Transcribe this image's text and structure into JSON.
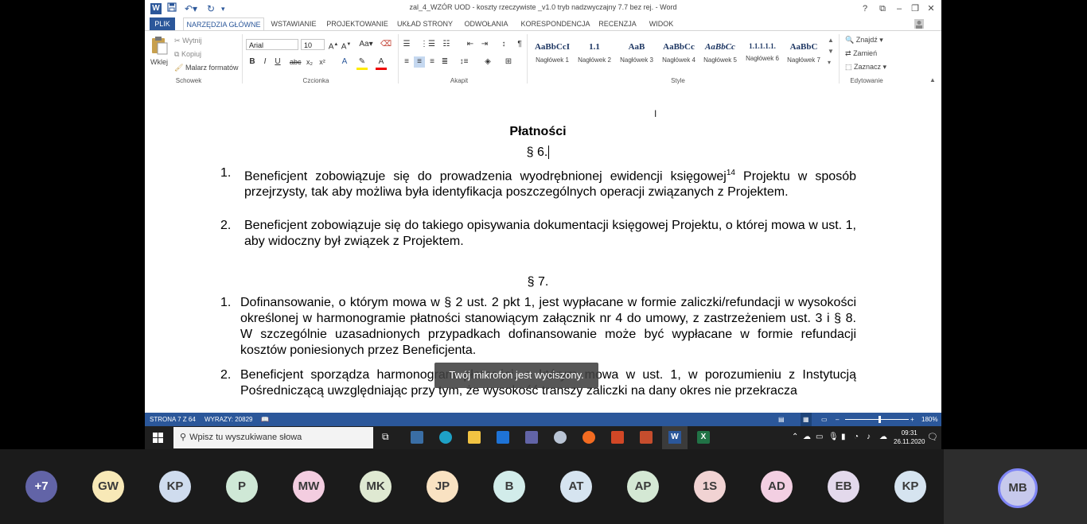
{
  "window": {
    "title": "zal_4_WZÓR UOD - koszty rzeczywiste _v1.0 tryb nadzwyczajny 7.7 bez rej. - Word",
    "help": "?",
    "controls": {
      "ribbon_opts": "⧉",
      "minimize": "–",
      "restore": "❐",
      "close": "✕"
    }
  },
  "tabs": [
    "PLIK",
    "NARZĘDZIA GŁÓWNE",
    "WSTAWIANIE",
    "PROJEKTOWANIE",
    "UKŁAD STRONY",
    "ODWOŁANIA",
    "KORESPONDENCJA",
    "RECENZJA",
    "WIDOK"
  ],
  "ribbon": {
    "clipboard": {
      "paste": "Wklej",
      "cut": "Wytnij",
      "copy": "Kopiuj",
      "format_painter": "Malarz formatów",
      "label": "Schowek"
    },
    "font": {
      "name": "Arial",
      "size": "10",
      "label": "Czcionka"
    },
    "paragraph": {
      "label": "Akapit"
    },
    "styles": {
      "label": "Style",
      "items": [
        {
          "sample": "AaBbCcI",
          "name": "Nagłówek 1"
        },
        {
          "sample": "1.1",
          "name": "Nagłówek 2"
        },
        {
          "sample": "AaB",
          "name": "Nagłówek 3"
        },
        {
          "sample": "AaBbCc",
          "name": "Nagłówek 4"
        },
        {
          "sample": "AaBbCc",
          "name": "Nagłówek 4"
        },
        {
          "sample": "AaBbCc",
          "name": "Nagłówek 5"
        },
        {
          "sample": "1.1.1.1.1.",
          "name": "Nagłówek 6"
        },
        {
          "sample": "AaBbC",
          "name": "Nagłówek 7"
        }
      ]
    },
    "editing": {
      "find": "Znajdź",
      "replace": "Zamień",
      "select": "Zaznacz",
      "label": "Edytowanie"
    }
  },
  "document": {
    "heading": "Płatności",
    "section6": "§ 6.",
    "s6_items": [
      {
        "num": "1.",
        "text_before": "Beneficjent zobowiązuje się do prowadzenia wyodrębnionej ewidencji księgowej",
        "sup": "14",
        "text_after": " Projektu w sposób przejrzysty, tak aby możliwa była identyfikacja poszczególnych operacji związanych z Projektem."
      },
      {
        "num": "2.",
        "text": "Beneficjent zobowiązuje się do takiego opisywania dokumentacji księgowej Projektu, o której mowa w ust. 1, aby widoczny był związek z Projektem."
      }
    ],
    "section7": "§ 7.",
    "s7_items": [
      {
        "num": "1.",
        "text": "Dofinansowanie, o którym mowa w § 2 ust. 2 pkt 1, jest wypłacane w formie zaliczki/refundacji w wysokości określonej w harmonogramie płatności stanowiącym załącznik nr 4 do umowy, z zastrzeżeniem ust. 3 i § 8. W szczególnie uzasadnionych przypadkach dofinansowanie może być wypłacane w formie refundacji kosztów poniesionych przez Beneficjenta."
      },
      {
        "num": "2.",
        "text": "Beneficjent sporządza harmonogram płatności, o którym mowa w ust. 1, w porozumieniu z Instytucją Pośredniczącą uwzględniając przy tym, że wysokość transzy zaliczki na dany okres nie przekracza"
      }
    ],
    "toast": "Twój mikrofon jest wyciszony."
  },
  "statusbar": {
    "page": "STRONA 7 Z 64",
    "words": "WYRAZY: 20829",
    "zoom": "180%"
  },
  "taskbar": {
    "search_placeholder": "Wpisz tu wyszukiwane słowa",
    "time": "09:31",
    "date": "26.11.2020"
  },
  "meeting": {
    "participants": [
      {
        "initials": "+7",
        "color": "#6264a7"
      },
      {
        "initials": "GW",
        "color": "#f8e9b7"
      },
      {
        "initials": "KP",
        "color": "#cfdcee"
      },
      {
        "initials": "P",
        "color": "#cfe8d6"
      },
      {
        "initials": "MW",
        "color": "#f3cde0"
      },
      {
        "initials": "MK",
        "color": "#dfe9d2"
      },
      {
        "initials": "JP",
        "color": "#f9e2c2"
      },
      {
        "initials": "B",
        "color": "#d2ecea"
      },
      {
        "initials": "AT",
        "color": "#d6e4f0"
      },
      {
        "initials": "AP",
        "color": "#d4e8d4"
      },
      {
        "initials": "1S",
        "color": "#f1d3d3"
      },
      {
        "initials": "AD",
        "color": "#f3cfe2"
      },
      {
        "initials": "EB",
        "color": "#e3d9ec"
      },
      {
        "initials": "KP",
        "color": "#d6e4f0"
      }
    ],
    "self": {
      "initials": "MB",
      "color": "#c7c9ec"
    }
  }
}
